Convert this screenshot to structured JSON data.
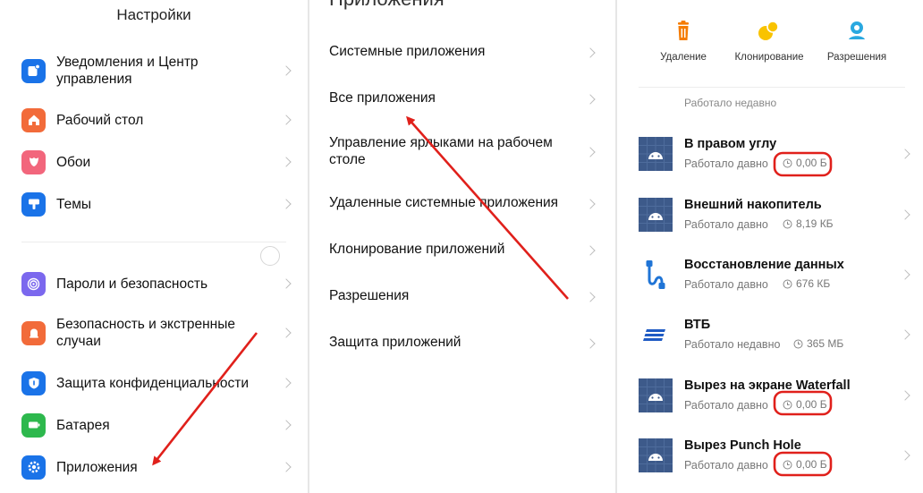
{
  "settings": {
    "title": "Настройки",
    "items": [
      {
        "label": "Уведомления и Центр управления",
        "icon": "notifications-icon",
        "color": "#1a73e8"
      },
      {
        "label": "Рабочий стол",
        "icon": "home-icon",
        "color": "#f26b3a"
      },
      {
        "label": "Обои",
        "icon": "wallpaper-flower-icon",
        "color": "#f2667c"
      },
      {
        "label": "Темы",
        "icon": "themes-brush-icon",
        "color": "#1a73e8"
      },
      {
        "label": "Пароли и безопасность",
        "icon": "fingerprint-icon",
        "color": "#7b68ee"
      },
      {
        "label": "Безопасность и экстренные случаи",
        "icon": "emergency-bell-icon",
        "color": "#f26b3a"
      },
      {
        "label": "Защита конфиденциальности",
        "icon": "privacy-shield-icon",
        "color": "#1a73e8"
      },
      {
        "label": "Батарея",
        "icon": "battery-icon",
        "color": "#2db84d"
      },
      {
        "label": "Приложения",
        "icon": "apps-gear-icon",
        "color": "#1a73e8"
      }
    ]
  },
  "apps_menu": {
    "title": "Приложения",
    "items": [
      {
        "label": "Системные приложения"
      },
      {
        "label": "Все приложения"
      },
      {
        "label": "Управление ярлыками на рабочем столе"
      },
      {
        "label": "Удаленные системные приложения"
      },
      {
        "label": "Клонирование приложений"
      },
      {
        "label": "Разрешения"
      },
      {
        "label": "Защита приложений"
      }
    ]
  },
  "app_list": {
    "actions": [
      {
        "label": "Удаление",
        "icon": "trash-icon",
        "color": "#f57c00"
      },
      {
        "label": "Клонирование",
        "icon": "clone-circles-icon",
        "color": "#f9c300"
      },
      {
        "label": "Разрешения",
        "icon": "permissions-icon",
        "color": "#29a8e0"
      }
    ],
    "cut_row_text": "Работало недавно",
    "apps": [
      {
        "name": "В правом углу",
        "status": "Работало давно",
        "size": "0,00 Б",
        "icon": "android-app-icon"
      },
      {
        "name": "Внешний накопитель",
        "status": "Работало давно",
        "size": "8,19 КБ",
        "icon": "android-app-icon"
      },
      {
        "name": "Восстановление данных",
        "status": "Работало давно",
        "size": "676 КБ",
        "icon": "data-recovery-icon"
      },
      {
        "name": "ВТБ",
        "status": "Работало недавно",
        "size": "365 МБ",
        "icon": "vtb-logo-icon"
      },
      {
        "name": "Вырез на экране Waterfall",
        "status": "Работало давно",
        "size": "0,00 Б",
        "icon": "android-app-icon"
      },
      {
        "name": "Вырез Punch Hole",
        "status": "Работало давно",
        "size": "0,00 Б",
        "icon": "android-app-icon"
      }
    ]
  },
  "annotation_color": "#e0201b"
}
